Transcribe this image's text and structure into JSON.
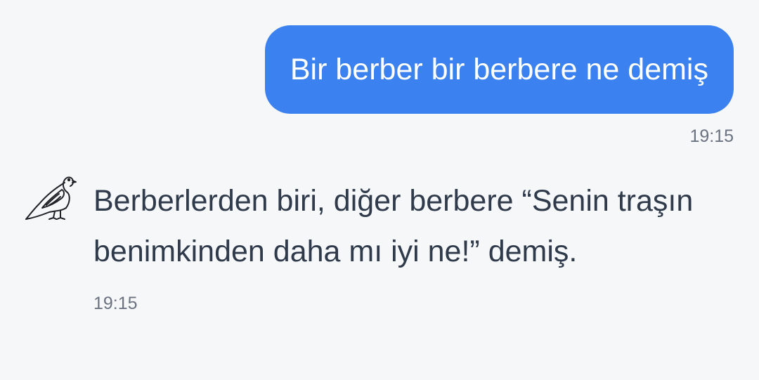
{
  "messages": [
    {
      "role": "user",
      "text": "Bir berber bir berbere ne demiş",
      "time": "19:15",
      "bubble_color": "#3b82f0"
    },
    {
      "role": "assistant",
      "avatar_icon": "dove-icon",
      "text": "Berberlerden biri, diğer berbere “Senin traşın benimkinden daha mı iyi ne!” demiş.",
      "time": "19:15"
    }
  ]
}
